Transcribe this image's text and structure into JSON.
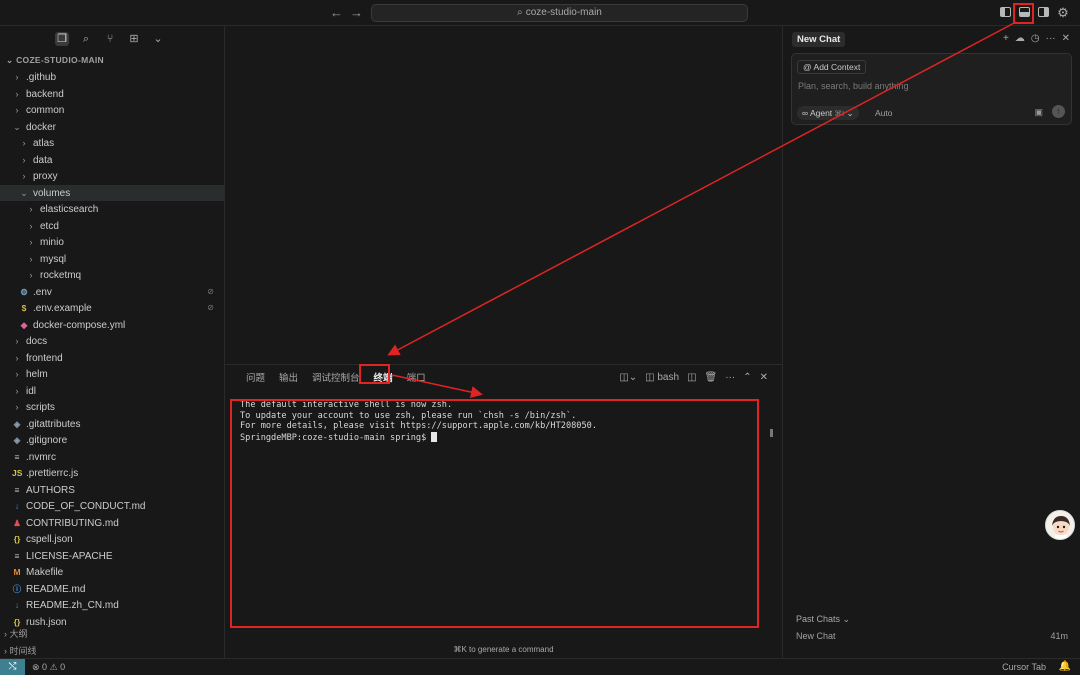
{
  "titlebar": {
    "search_text": "coze-studio-main",
    "back_icon": "←",
    "forward_icon": "→"
  },
  "sidebar": {
    "root_title": "COZE-STUDIO-MAIN",
    "tree": [
      {
        "label": ".github",
        "depth": 0,
        "type": "folder",
        "open": false
      },
      {
        "label": "backend",
        "depth": 0,
        "type": "folder",
        "open": false
      },
      {
        "label": "common",
        "depth": 0,
        "type": "folder",
        "open": false
      },
      {
        "label": "docker",
        "depth": 0,
        "type": "folder",
        "open": true
      },
      {
        "label": "atlas",
        "depth": 1,
        "type": "folder",
        "open": false
      },
      {
        "label": "data",
        "depth": 1,
        "type": "folder",
        "open": false
      },
      {
        "label": "proxy",
        "depth": 1,
        "type": "folder",
        "open": false
      },
      {
        "label": "volumes",
        "depth": 1,
        "type": "folder",
        "open": true,
        "selected": true
      },
      {
        "label": "elasticsearch",
        "depth": 2,
        "type": "folder",
        "open": false
      },
      {
        "label": "etcd",
        "depth": 2,
        "type": "folder",
        "open": false
      },
      {
        "label": "minio",
        "depth": 2,
        "type": "folder",
        "open": false
      },
      {
        "label": "mysql",
        "depth": 2,
        "type": "folder",
        "open": false
      },
      {
        "label": "rocketmq",
        "depth": 2,
        "type": "folder",
        "open": false
      },
      {
        "label": ".env",
        "depth": 1,
        "type": "file",
        "icon": "⚙",
        "color": "#7fa7c9",
        "badge": "⊘"
      },
      {
        "label": ".env.example",
        "depth": 1,
        "type": "file",
        "icon": "$",
        "color": "#d4b64a",
        "badge": "⊘"
      },
      {
        "label": "docker-compose.yml",
        "depth": 1,
        "type": "file",
        "icon": "◆",
        "color": "#e0649a"
      },
      {
        "label": "docs",
        "depth": 0,
        "type": "folder",
        "open": false
      },
      {
        "label": "frontend",
        "depth": 0,
        "type": "folder",
        "open": false
      },
      {
        "label": "helm",
        "depth": 0,
        "type": "folder",
        "open": false
      },
      {
        "label": "idl",
        "depth": 0,
        "type": "folder",
        "open": false
      },
      {
        "label": "scripts",
        "depth": 0,
        "type": "folder",
        "open": false
      },
      {
        "label": ".gitattributes",
        "depth": 0,
        "type": "file",
        "icon": "◈",
        "color": "#8a9aa8"
      },
      {
        "label": ".gitignore",
        "depth": 0,
        "type": "file",
        "icon": "◈",
        "color": "#8a9aa8"
      },
      {
        "label": ".nvmrc",
        "depth": 0,
        "type": "file",
        "icon": "≡",
        "color": "#bbbbbb"
      },
      {
        "label": ".prettierrc.js",
        "depth": 0,
        "type": "file",
        "icon": "JS",
        "color": "#d4c44a"
      },
      {
        "label": "AUTHORS",
        "depth": 0,
        "type": "file",
        "icon": "≡",
        "color": "#bbbbbb"
      },
      {
        "label": "CODE_OF_CONDUCT.md",
        "depth": 0,
        "type": "file",
        "icon": "↓",
        "color": "#4a90d4"
      },
      {
        "label": "CONTRIBUTING.md",
        "depth": 0,
        "type": "file",
        "icon": "♟",
        "color": "#e05050"
      },
      {
        "label": "cspell.json",
        "depth": 0,
        "type": "file",
        "icon": "{}",
        "color": "#d4c44a"
      },
      {
        "label": "LICENSE-APACHE",
        "depth": 0,
        "type": "file",
        "icon": "≡",
        "color": "#bbbbbb"
      },
      {
        "label": "Makefile",
        "depth": 0,
        "type": "file",
        "icon": "M",
        "color": "#e08a3a"
      },
      {
        "label": "README.md",
        "depth": 0,
        "type": "file",
        "icon": "ⓘ",
        "color": "#4a90d4"
      },
      {
        "label": "README.zh_CN.md",
        "depth": 0,
        "type": "file",
        "icon": "↓",
        "color": "#4a90d4"
      },
      {
        "label": "rush.json",
        "depth": 0,
        "type": "file",
        "icon": "{}",
        "color": "#d4c44a"
      }
    ],
    "outline_label": "大纲",
    "timeline_label": "时间线"
  },
  "panel": {
    "tabs": [
      "问题",
      "输出",
      "调试控制台",
      "终端",
      "端口"
    ],
    "active_tab": "终端",
    "shell_label": "bash",
    "terminal_lines": [
      "The default interactive shell is now zsh.",
      "To update your account to use zsh, please run `chsh -s /bin/zsh`.",
      "For more details, please visit https://support.apple.com/kb/HT208050."
    ],
    "prompt": "SpringdeMBP:coze-studio-main spring$ ",
    "cmdk_hint": "⌘K to generate a command"
  },
  "chat": {
    "tab_label": "New Chat",
    "add_context_label": "Add Context",
    "placeholder": "Plan, search, build anything",
    "agent_label": "Agent",
    "agent_shortcut": "⌘I",
    "model_label": "Auto",
    "past_chats_label": "Past Chats",
    "past_items": [
      {
        "title": "New Chat",
        "age": "41m"
      }
    ]
  },
  "statusbar": {
    "errors": "0",
    "warnings": "0",
    "right_label": "Cursor Tab"
  },
  "colors": {
    "annotation": "#e02424",
    "remote_bg": "#3e7f90"
  }
}
